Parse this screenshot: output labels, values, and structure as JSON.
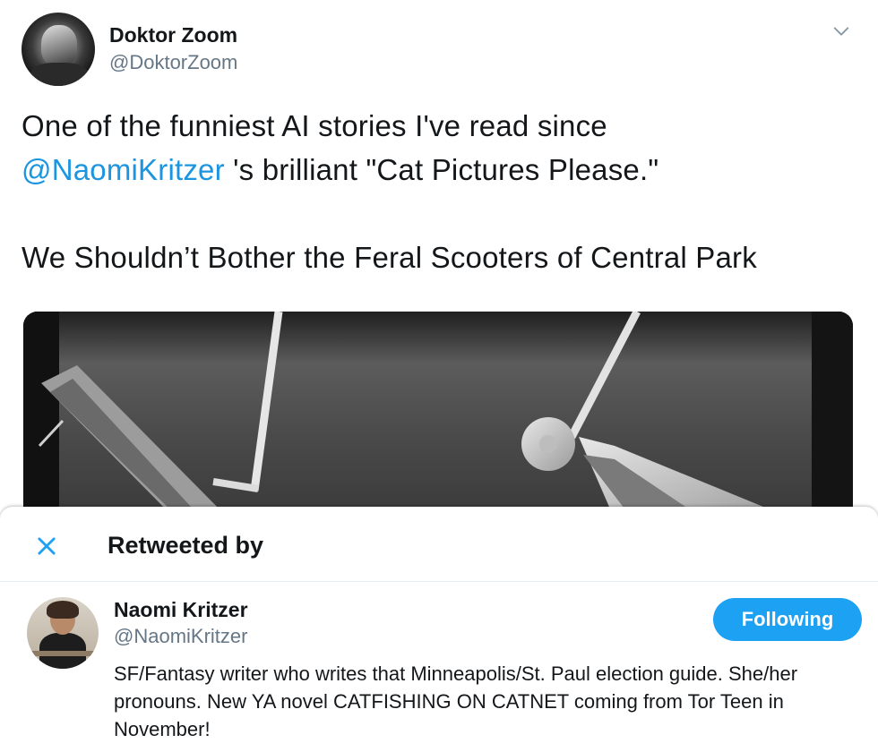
{
  "tweet": {
    "author_name": "Doktor Zoom",
    "author_handle": "@DoktorZoom",
    "text_line1": "One of the funniest AI stories I've read since",
    "mention": "@NaomiKritzer",
    "text_line2_rest": " 's brilliant \"Cat Pictures Please.\"",
    "story_title": "We Shouldn’t Bother the Feral Scooters of Central Park",
    "menu_icon": "chevron-down-icon",
    "media_alt": "photo of electric scooters"
  },
  "modal": {
    "title": "Retweeted by",
    "close_icon": "close-icon",
    "accent_color": "#1da1f2",
    "users": [
      {
        "name": "Naomi Kritzer",
        "handle": "@NaomiKritzer",
        "button_label": "Following",
        "bio": "SF/Fantasy writer who writes that Minneapolis/St. Paul election guide. She/her pronouns. New YA novel CATFISHING ON CATNET coming from Tor Teen in November!"
      }
    ]
  }
}
